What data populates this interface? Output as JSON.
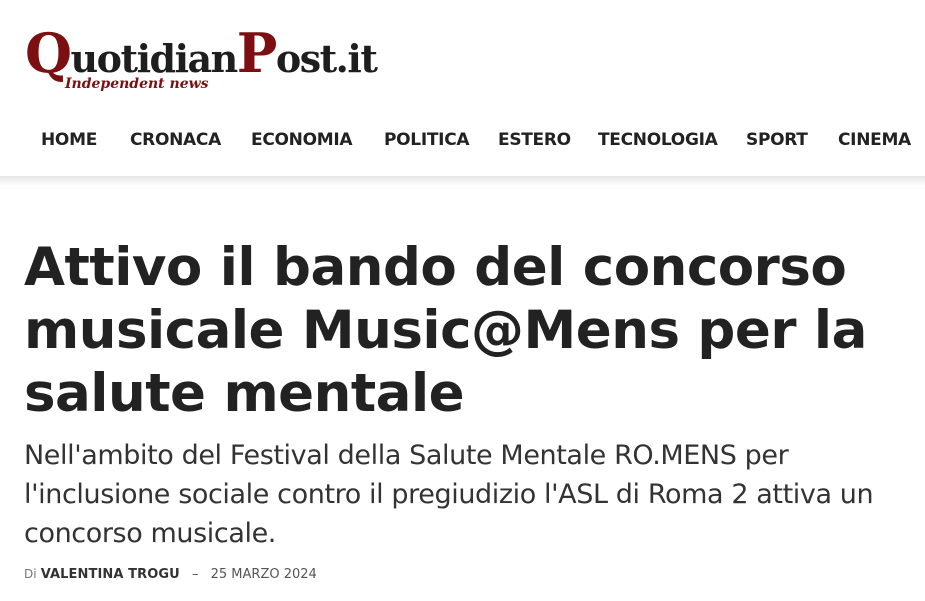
{
  "site": {
    "logo_q": "Q",
    "logo_uotidian": "uotidian",
    "logo_p": "P",
    "logo_ost": "ost.it",
    "tagline": "Independent news"
  },
  "nav": {
    "items": [
      {
        "label": "HOME"
      },
      {
        "label": "CRONACA"
      },
      {
        "label": "ECONOMIA"
      },
      {
        "label": "POLITICA"
      },
      {
        "label": "ESTERO"
      },
      {
        "label": "TECNOLOGIA"
      },
      {
        "label": "SPORT"
      },
      {
        "label": "CINEMA"
      }
    ]
  },
  "article": {
    "title": "Attivo il bando del concorso musicale Music@Mens per la salute mentale",
    "subtitle": "Nell'ambito del Festival della Salute Mentale RO.MENS per l'inclusione sociale contro il pregiudizio l'ASL di Roma 2 attiva un concorso musicale.",
    "by_label": "Di",
    "author": "VALENTINA TROGU",
    "separator": "–",
    "date": "25 MARZO 2024"
  },
  "colors": {
    "brand": "#7b0f12",
    "text": "#222222"
  }
}
